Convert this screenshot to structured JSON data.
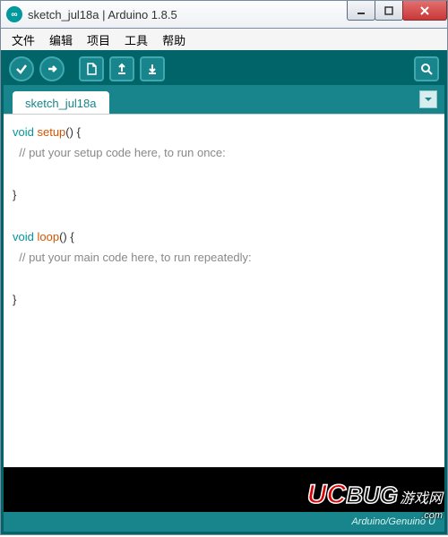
{
  "window": {
    "title": "sketch_jul18a | Arduino 1.8.5",
    "logo_glyph": "∞"
  },
  "menu": {
    "file": "文件",
    "edit": "编辑",
    "project": "项目",
    "tools": "工具",
    "help": "帮助"
  },
  "tabs": {
    "active": "sketch_jul18a"
  },
  "code": {
    "l1_kw": "void",
    "l1_fn": "setup",
    "l1_rest": "() {",
    "l2_comment": "// put your setup code here, to run once:",
    "l3": "}",
    "l4_kw": "void",
    "l4_fn": "loop",
    "l4_rest": "() {",
    "l5_comment": "// put your main code here, to run repeatedly:",
    "l6": "}"
  },
  "status": {
    "board": "Arduino/Genuino U"
  },
  "watermark": {
    "uc": "UC",
    "bug": "BUG",
    "cn": "游戏网",
    "com": ".com"
  }
}
